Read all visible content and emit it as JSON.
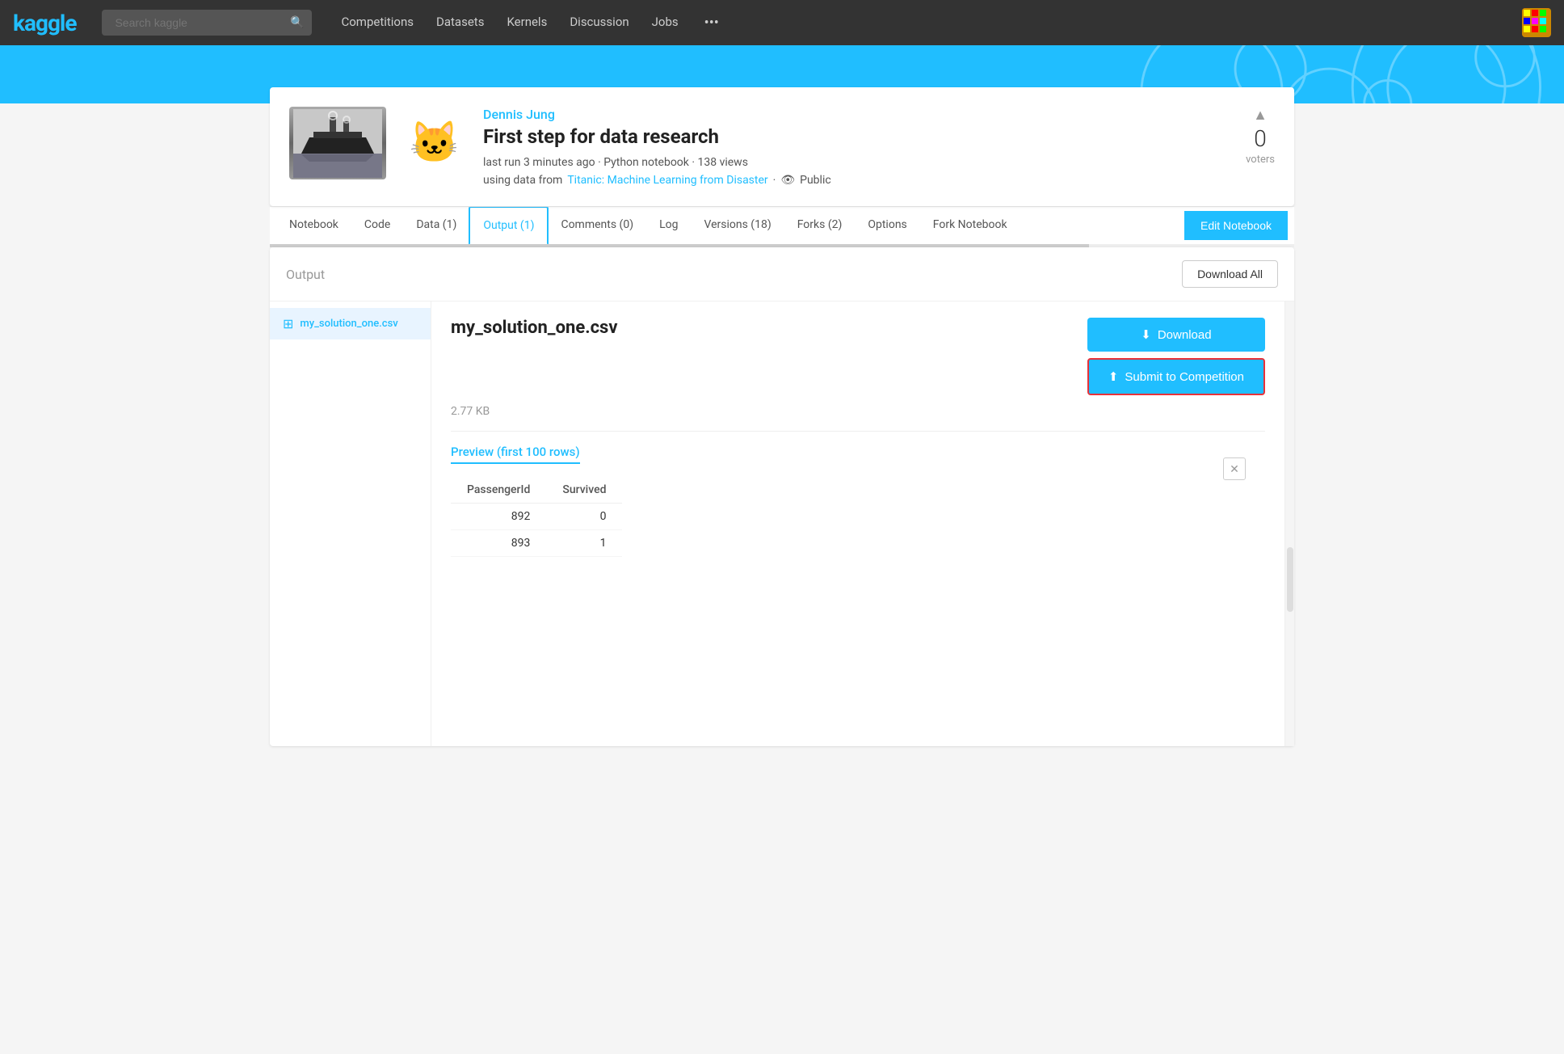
{
  "navbar": {
    "logo": "kaggle",
    "search_placeholder": "Search kaggle",
    "links": [
      {
        "label": "Competitions",
        "active": false
      },
      {
        "label": "Datasets",
        "active": false
      },
      {
        "label": "Kernels",
        "active": false
      },
      {
        "label": "Discussion",
        "active": false
      },
      {
        "label": "Jobs",
        "active": false
      }
    ],
    "more_label": "•••"
  },
  "kernel": {
    "author": "Dennis Jung",
    "title": "First step for data research",
    "meta": "last run 3 minutes ago · Python notebook · 138 views",
    "data_link": "Titanic: Machine Learning from Disaster",
    "visibility": "Public",
    "voters_count": "0",
    "voters_label": "voters"
  },
  "tabs": [
    {
      "label": "Notebook",
      "active": false
    },
    {
      "label": "Code",
      "active": false
    },
    {
      "label": "Data (1)",
      "active": false
    },
    {
      "label": "Output (1)",
      "active": true
    },
    {
      "label": "Comments (0)",
      "active": false
    },
    {
      "label": "Log",
      "active": false
    },
    {
      "label": "Versions (18)",
      "active": false
    },
    {
      "label": "Forks (2)",
      "active": false
    },
    {
      "label": "Options",
      "active": false
    },
    {
      "label": "Fork Notebook",
      "active": false
    }
  ],
  "edit_button": "Edit Notebook",
  "output_section": {
    "title": "Output",
    "download_all_btn": "Download All",
    "file": {
      "name": "my_solution_one.csv",
      "icon": "table-icon",
      "size": "2.77 KB",
      "download_btn": "Download",
      "submit_btn": "Submit to Competition",
      "preview_title": "Preview (first 100 rows)",
      "table": {
        "headers": [
          "PassengerId",
          "Survived"
        ],
        "rows": [
          {
            "col1": "892",
            "col2": "0"
          },
          {
            "col1": "893",
            "col2": "1"
          }
        ]
      }
    }
  },
  "icons": {
    "search": "🔍",
    "upload": "⬆",
    "download": "⬇",
    "table": "⊞",
    "eye": "👁",
    "close": "✕",
    "chevron_up": "▲"
  }
}
